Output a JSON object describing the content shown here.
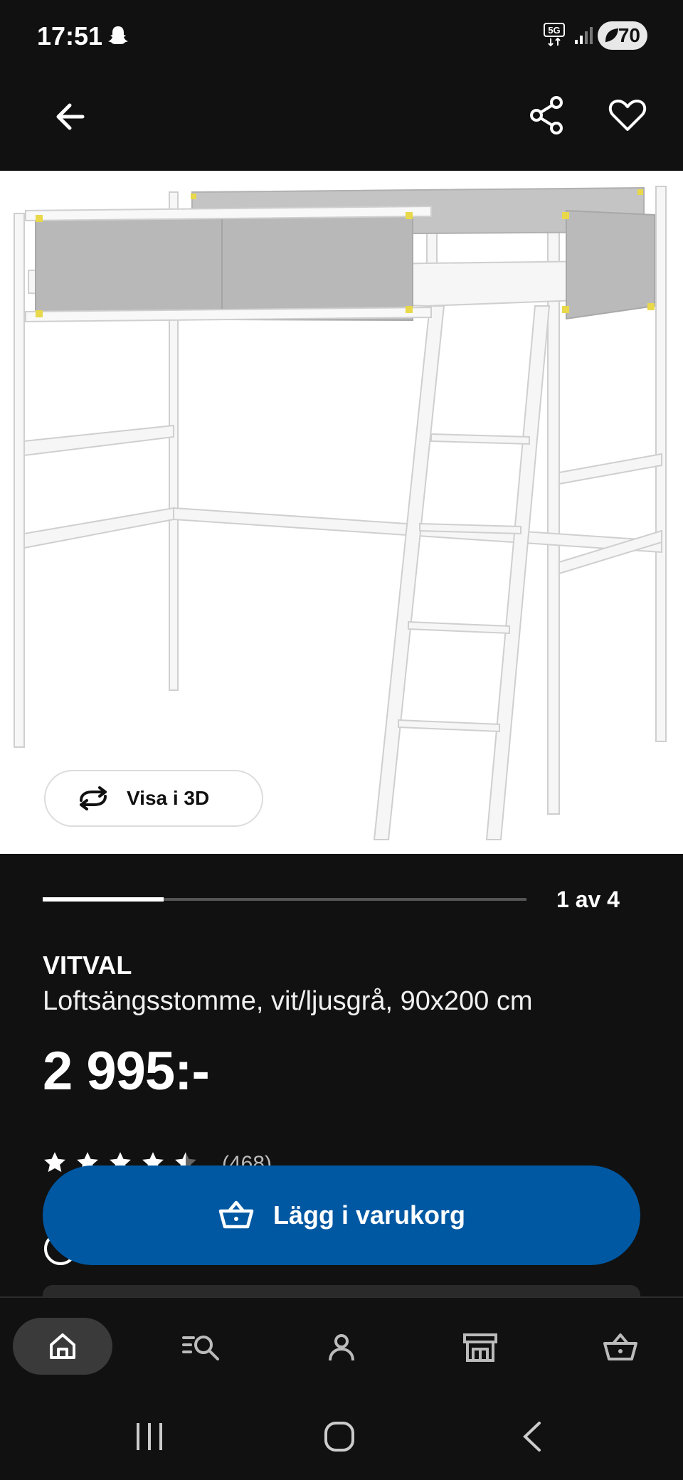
{
  "status_bar": {
    "time": "17:51",
    "network": "5G",
    "battery": "70"
  },
  "product": {
    "name": "VITVAL",
    "description": "Loftsängsstomme, vit/ljusgrå, 90x200 cm",
    "price": "2 995:-",
    "rating": 4.5,
    "rating_count": "(468)"
  },
  "gallery": {
    "view3d_label": "Visa i 3D",
    "pager_label": "1 av 4",
    "progress": 0.25
  },
  "actions": {
    "add_to_cart_label": "Lägg i varukorg"
  },
  "bottom_nav": {
    "items": [
      "home-icon",
      "search-icon",
      "profile-icon",
      "store-icon",
      "cart-icon"
    ],
    "active": "home-icon"
  },
  "colors": {
    "accent": "#0058a3",
    "background": "#111111"
  }
}
